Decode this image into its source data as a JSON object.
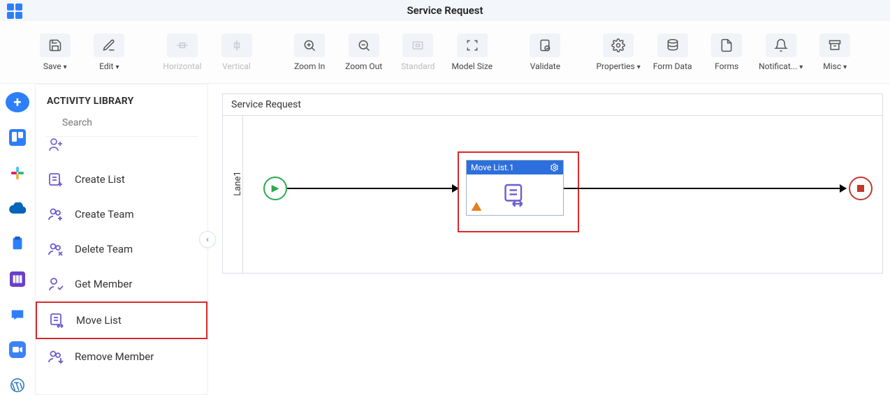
{
  "title": "Service Request",
  "toolbar": {
    "save": "Save",
    "edit": "Edit",
    "horizontal": "Horizontal",
    "vertical": "Vertical",
    "zoom_in": "Zoom In",
    "zoom_out": "Zoom Out",
    "standard": "Standard",
    "model_size": "Model Size",
    "validate": "Validate",
    "properties": "Properties",
    "form_data": "Form Data",
    "forms": "Forms",
    "notifications": "Notificat...",
    "misc": "Misc"
  },
  "library": {
    "heading": "ACTIVITY LIBRARY",
    "search_placeholder": "Search",
    "items": [
      {
        "label": "Create List"
      },
      {
        "label": "Create Team"
      },
      {
        "label": "Delete Team"
      },
      {
        "label": "Get Member"
      },
      {
        "label": "Move List",
        "highlight": true
      },
      {
        "label": "Remove Member"
      }
    ]
  },
  "canvas": {
    "pool_title": "Service Request",
    "lane_label": "Lane1",
    "task_title": "Move List.1"
  }
}
